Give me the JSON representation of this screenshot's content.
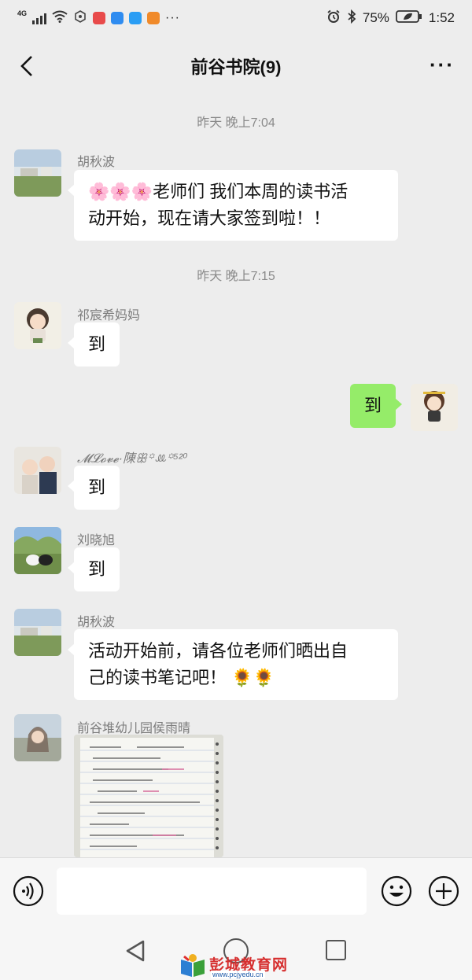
{
  "status_bar": {
    "network": "4G",
    "battery": "75%",
    "time": "1:52"
  },
  "header": {
    "title": "前谷书院(9)",
    "more": "···"
  },
  "messages": [
    {
      "time": "昨天 晚上7:04"
    },
    {
      "sender": "胡秋波",
      "text": "🌸🌸🌸老师们 我们本周的读书活动开始，现在请大家签到啦！！",
      "line1": "🌸🌸🌸老师们 我们本周的读书活",
      "line2": "动开始，现在请大家签到啦！！"
    },
    {
      "time": "昨天 晚上7:15"
    },
    {
      "sender": "祁宸希妈妈",
      "text": "到"
    },
    {
      "sender": "me",
      "text": "到"
    },
    {
      "sender": "𝓜𝓛𝓸𝓿𝓮·陳ꕥ꙳ꔛ꙳⁵²⁰",
      "text": "到"
    },
    {
      "sender": "刘晓旭",
      "text": "到"
    },
    {
      "sender": "胡秋波",
      "line1": "活动开始前，请各位老师们晒出自",
      "line2": "己的读书笔记吧！ 🌻🌻"
    },
    {
      "sender": "前谷堆幼儿园侯雨晴",
      "type": "image"
    }
  ],
  "watermark": {
    "name": "彭城教育网",
    "url": "www.pcjyedu.cn"
  },
  "colors": {
    "background": "#ededed",
    "bubble_mine": "#95ec69",
    "bubble_other": "#ffffff"
  }
}
